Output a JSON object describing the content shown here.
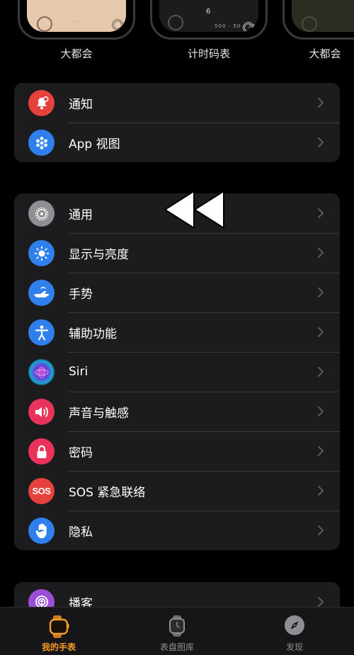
{
  "faces": [
    {
      "label": "大都会"
    },
    {
      "label": "计时码表",
      "dial_number": "6",
      "dial_scale": "500 - 50 - 30"
    },
    {
      "label": "大都会"
    }
  ],
  "groups": [
    {
      "items": [
        {
          "label": "通知",
          "icon": "bell-icon",
          "color": "#e5413d"
        },
        {
          "label": "App 视图",
          "icon": "app-grid-icon",
          "color": "#2f7fec"
        }
      ]
    },
    {
      "items": [
        {
          "label": "通用",
          "icon": "gear-icon",
          "color": "#8e8e93"
        },
        {
          "label": "显示与亮度",
          "icon": "sun-icon",
          "color": "#2f7fec"
        },
        {
          "label": "手势",
          "icon": "hand-gesture-icon",
          "color": "#2f7fec"
        },
        {
          "label": "辅助功能",
          "icon": "accessibility-icon",
          "color": "#2f7fec"
        },
        {
          "label": "Siri",
          "icon": "siri-icon",
          "color": "#000000"
        },
        {
          "label": "声音与触感",
          "icon": "speaker-icon",
          "color": "#e9335a"
        },
        {
          "label": "密码",
          "icon": "lock-icon",
          "color": "#e9335a"
        },
        {
          "label": "SOS 紧急联络",
          "icon": "sos-icon",
          "color": "#e5413d",
          "badge": "SOS"
        },
        {
          "label": "隐私",
          "icon": "hand-raised-icon",
          "color": "#2f7fec"
        }
      ]
    },
    {
      "items": [
        {
          "label": "播客",
          "icon": "podcasts-icon",
          "color": "#9b4fd8"
        }
      ]
    }
  ],
  "overlay": {
    "icon": "rewind-icon"
  },
  "tabs": [
    {
      "label": "我的手表",
      "icon": "watch-icon",
      "active": true
    },
    {
      "label": "表盘图库",
      "icon": "watch-face-gallery-icon",
      "active": false
    },
    {
      "label": "发现",
      "icon": "compass-icon",
      "active": false
    }
  ],
  "colors": {
    "accent": "#f59b28",
    "background": "#000000",
    "cell": "#1c1c1e"
  }
}
